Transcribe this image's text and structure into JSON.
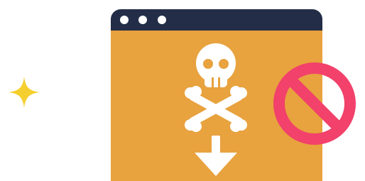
{
  "illustration": {
    "colors": {
      "window_titlebar": "#232d48",
      "window_body": "#e8a23e",
      "window_dots": "#ffffff",
      "skull": "#ffffff",
      "skull_features": "#e8a23e",
      "arrow": "#ffffff",
      "prohibition_sign": "#f2416b",
      "sparkle": "#f5cf2f"
    },
    "window_control_dots": 3,
    "icons": [
      "sparkle-icon",
      "skull-crossbones-icon",
      "download-arrow-icon",
      "prohibition-icon"
    ]
  }
}
